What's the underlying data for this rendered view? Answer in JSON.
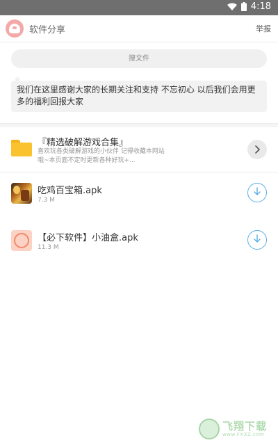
{
  "statusbar": {
    "time": "4:18"
  },
  "header": {
    "title": "软件分享",
    "report_label": "举报"
  },
  "search": {
    "placeholder": "搜文件"
  },
  "notice": {
    "text": "我们在这里感谢大家的长期关注和支持 不忘初心 以后我们会用更多的福利回报大家"
  },
  "folder": {
    "title": "『精选破解游戏合集』",
    "desc_line1": "喜欢玩各类破解游戏的小伙伴 记得收藏本网站",
    "desc_line2": "哦~本页面不定时更新各种好玩+..."
  },
  "files": [
    {
      "name": "吃鸡百宝箱.apk",
      "size": "7.3 M"
    },
    {
      "name": "【必下软件】小油盒.apk",
      "size": "11.3 M"
    }
  ],
  "watermark": {
    "brand": "飞翔下载",
    "url": "www.FXXZ.com"
  },
  "colors": {
    "accent": "#5aaee6",
    "folder": "#f9c22e",
    "statusbar": "#6f6f6f"
  }
}
